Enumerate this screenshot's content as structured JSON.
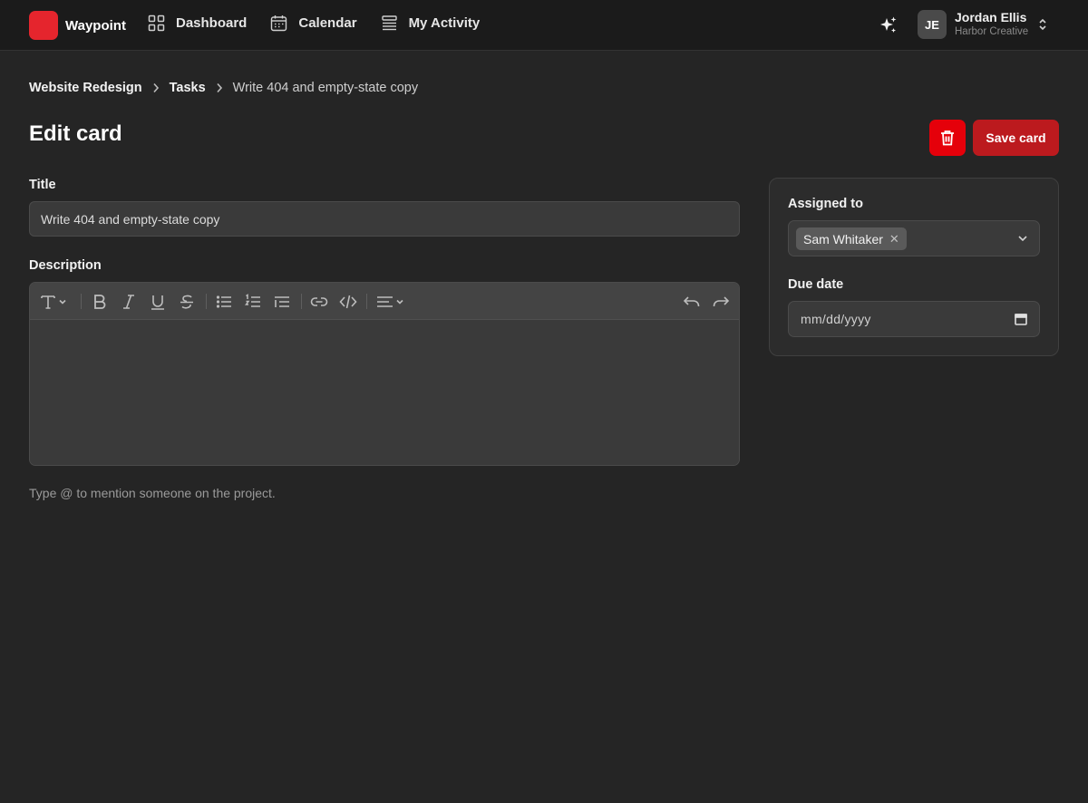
{
  "app": {
    "name": "Waypoint"
  },
  "nav": [
    {
      "label": "Dashboard",
      "icon": "grid-icon"
    },
    {
      "label": "Calendar",
      "icon": "calendar-icon"
    },
    {
      "label": "My Activity",
      "icon": "activity-list-icon"
    }
  ],
  "user": {
    "initials": "JE",
    "name": "Jordan Ellis",
    "org": "Harbor Creative"
  },
  "breadcrumb": {
    "project": "Website Redesign",
    "section": "Tasks",
    "current": "Write 404 and empty-state copy"
  },
  "page": {
    "title": "Edit card"
  },
  "actions": {
    "save_label": "Save card",
    "delete_icon": "trash-icon"
  },
  "form": {
    "title_label": "Title",
    "title_value": "Write 404 and empty-state copy",
    "description_label": "Description",
    "description_value": "",
    "hint": "Type @ to mention someone on the project."
  },
  "sidebar": {
    "assigned_label": "Assigned to",
    "assignees": [
      "Sam Whitaker"
    ],
    "due_label": "Due date",
    "due_placeholder": "mm/dd/yyyy"
  },
  "colors": {
    "background": "#252525",
    "topbar": "#1b1b1b",
    "brand": "#e5252d",
    "delete": "#e5000a",
    "save": "#bc1a1e",
    "input": "#3a3a3a"
  }
}
